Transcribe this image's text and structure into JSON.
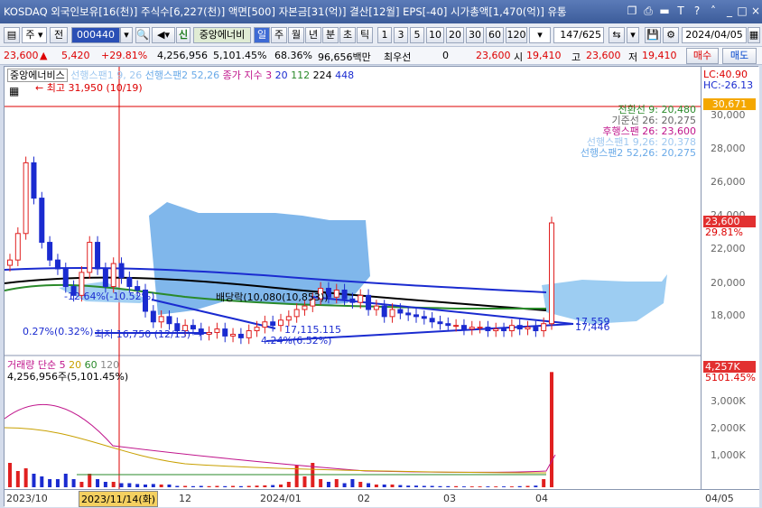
{
  "titlebar": {
    "text": "KOSDAQ 외국인보유[16(천)] 주식수[6,227(천)] 액면[500] 자본금[31(억)] 결산[12월] EPS[-40] 시가총액[1,470(억)] 유통",
    "icons": [
      "restore-icon",
      "print-icon",
      "minimize-icon",
      "help-icon",
      "pin-icon",
      "minimize-window-icon",
      "maximize-window-icon",
      "close-icon"
    ]
  },
  "toolbar": {
    "market": "주",
    "prev_label": "전",
    "code": "000440",
    "stock_name": "중앙에너비",
    "period_selected": "일",
    "periods": [
      "주",
      "월",
      "년",
      "분",
      "초",
      "틱"
    ],
    "intervals": [
      "1",
      "3",
      "5",
      "10",
      "20",
      "30",
      "60",
      "120"
    ],
    "count": "147",
    "total": "/625",
    "date": "2024/04/05"
  },
  "pricebar": {
    "price": "23,600",
    "change": "5,420",
    "rate": "+29.81%",
    "volume": "4,256,956",
    "vol_rate": "5,101.45%",
    "ratio": "68.36%",
    "amount": "96,656백만",
    "pref_label": "최우선",
    "pref_val": "0",
    "ask": "23,600",
    "open_label": "시",
    "open": "19,410",
    "high_label": "고",
    "high": "23,600",
    "low_label": "저",
    "low": "19,410",
    "buy": "매수",
    "sell": "매도"
  },
  "chart": {
    "legend_name": "중앙에너비스",
    "legend_span1": "선행스팬1 9, 26",
    "legend_span2": "선행스팬2 52,26",
    "legend_close": "종가 지수 3",
    "legend_mas": [
      "20",
      "112",
      "224",
      "448"
    ],
    "max_label": "최고 31,950 (10/19)",
    "min_label": "최저 16,750 (12/13)",
    "lc": "LC:40.90",
    "hc": "HC:-26.13",
    "ichimoku": [
      "전환선 9: 20,480",
      "기준선 26: 20,275",
      "후행스팬 26: 23,600",
      "선행스팬1 9,26: 20,378",
      "선행스팬2 52,26: 20,275"
    ],
    "annotations": {
      "a1": "-12.64%(-10.52%)",
      "a2": "0.27%(0.32%)",
      "a3": "17,115.115",
      "a4": "4.24%(6.52%)",
      "a5": "배당락(10,080(10,853))",
      "a6": "17,559",
      "a7": "17,446"
    },
    "price_ticks": [
      "30,000",
      "28,000",
      "26,000",
      "24,000",
      "22,000",
      "20,000",
      "18,000"
    ],
    "price_tag_high": "30,671",
    "price_tag": "23,600",
    "rate_tag": "29.81%",
    "vol_legend": "거래량 단순 5",
    "vol_mas": [
      "20",
      "60",
      "120"
    ],
    "vol_info": "4,256,956주(5,101.45%)",
    "vol_ticks": [
      "3,000K",
      "2,000K",
      "1,000K"
    ],
    "vol_tag": "4,257K",
    "vol_tag_rate": "5101.45%",
    "x_labels": [
      "2023/10",
      "12",
      "2024/01",
      "02",
      "03",
      "04",
      "04/05"
    ],
    "crosshair_date": "2023/11/14(화)"
  },
  "chart_data": {
    "type": "candlestick",
    "ylim": [
      16200,
      30900
    ],
    "closes": [
      21500,
      23000,
      27000,
      25000,
      22500,
      21500,
      21000,
      20000,
      19500,
      20800,
      22500,
      21000,
      20000,
      21300,
      20500,
      20000,
      19800,
      18600,
      18000,
      18300,
      17900,
      17500,
      17800,
      17600,
      17300,
      17400,
      17600,
      17200,
      17300,
      17100,
      17500,
      17700,
      18000,
      17800,
      18100,
      18300,
      18700,
      18900,
      19300,
      19900,
      19400,
      19800,
      19300,
      19100,
      19500,
      18700,
      18900,
      18300,
      18700,
      18500,
      18400,
      18300,
      18200,
      18000,
      17900,
      17800,
      17800,
      17600,
      17700,
      17700,
      17500,
      17600,
      17500,
      17800,
      17600,
      17700,
      17500,
      17900,
      23600
    ],
    "volumes": [
      0.9,
      0.6,
      0.7,
      0.5,
      0.4,
      0.3,
      0.3,
      0.5,
      0.3,
      0.2,
      0.5,
      0.3,
      0.2,
      0.2,
      0.15,
      0.15,
      0.12,
      0.1,
      0.12,
      0.1,
      0.1,
      0.05,
      0.05,
      0.04,
      0.05,
      0.04,
      0.05,
      0.04,
      0.05,
      0.04,
      0.05,
      0.06,
      0.07,
      0.08,
      0.1,
      0.2,
      0.8,
      0.4,
      0.9,
      0.3,
      0.2,
      0.3,
      0.15,
      0.3,
      0.2,
      0.15,
      0.1,
      0.1,
      0.1,
      0.08,
      0.06,
      0.06,
      0.05,
      0.05,
      0.04,
      0.04,
      0.04,
      0.03,
      0.03,
      0.03,
      0.03,
      0.03,
      0.03,
      0.03,
      0.04,
      0.05,
      0.06,
      0.3,
      4.256
    ]
  }
}
